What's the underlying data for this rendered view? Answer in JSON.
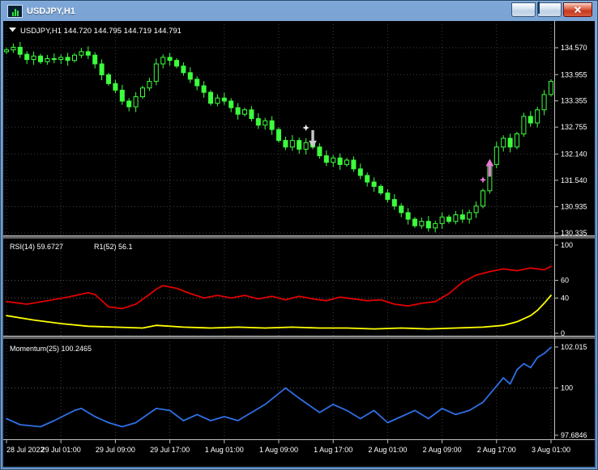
{
  "window": {
    "title": "USDJPY,H1"
  },
  "chart": {
    "ohlc_line": "USDJPY,H1 144.720 144.795 144.719 144.791"
  },
  "indicators": {
    "rsi": "RSI(14) 59.6727",
    "r1": "R1(52) 56.1",
    "momentum": "Momentum(25) 100.2465"
  },
  "colors": {
    "candle": "#3dff3d",
    "bull_fill": "#000000",
    "grid": "#3e3e3e",
    "level": "#5a5a5a",
    "frame": "#c0c0c0",
    "rsi_line": "#e00000",
    "r1_line": "#ffff00",
    "momentum_line": "#2f6fe4",
    "arrow_down": "#c9c9c9",
    "arrow_up": "#e878d8",
    "star_down": "#f2f2f2",
    "star_up": "#e878d8",
    "axis_text": "#ffffff"
  },
  "chart_data": [
    {
      "type": "candlestick",
      "symbol": "USDJPY",
      "timeframe": "H1",
      "ylim": [
        130.335,
        134.57
      ],
      "first_open": 134.48,
      "closes": [
        134.52,
        134.58,
        134.42,
        134.3,
        134.38,
        134.25,
        134.32,
        134.3,
        134.35,
        134.28,
        134.4,
        134.48,
        134.4,
        134.2,
        133.95,
        133.75,
        133.6,
        133.35,
        133.22,
        133.45,
        133.65,
        133.8,
        134.2,
        134.35,
        134.28,
        134.15,
        134.0,
        133.85,
        133.7,
        133.55,
        133.3,
        133.42,
        133.35,
        133.2,
        133.05,
        133.15,
        132.95,
        132.8,
        132.9,
        132.7,
        132.45,
        132.3,
        132.45,
        132.25,
        132.4,
        132.3,
        132.1,
        131.95,
        132.05,
        131.9,
        132.0,
        131.8,
        131.65,
        131.5,
        131.4,
        131.25,
        131.1,
        130.95,
        130.8,
        130.65,
        130.5,
        130.6,
        130.45,
        130.55,
        130.7,
        130.6,
        130.75,
        130.65,
        130.8,
        130.95,
        131.3,
        131.9,
        132.3,
        132.5,
        132.3,
        132.6,
        133.0,
        132.85,
        133.15,
        133.5,
        133.8
      ],
      "price_axis_labels": [
        "134.570",
        "133.955",
        "133.355",
        "132.755",
        "132.140",
        "131.540",
        "130.935",
        "130.335"
      ],
      "time_axis_labels": [
        {
          "i": 0,
          "label": "28 Jul 2022"
        },
        {
          "i": 8,
          "label": "29 Jul 01:00"
        },
        {
          "i": 16,
          "label": "29 Jul 09:00"
        },
        {
          "i": 24,
          "label": "29 Jul 17:00"
        },
        {
          "i": 32,
          "label": "1 Aug 01:00"
        },
        {
          "i": 40,
          "label": "1 Aug 09:00"
        },
        {
          "i": 48,
          "label": "1 Aug 17:00"
        },
        {
          "i": 56,
          "label": "2 Aug 01:00"
        },
        {
          "i": 64,
          "label": "2 Aug 09:00"
        },
        {
          "i": 72,
          "label": "2 Aug 17:00"
        },
        {
          "i": 80,
          "label": "3 Aug 01:00"
        }
      ],
      "markers": [
        {
          "kind": "arrow-down",
          "i": 45,
          "price": 132.28
        },
        {
          "kind": "star-down",
          "i": 44,
          "price": 132.74
        },
        {
          "kind": "arrow-up",
          "i": 71,
          "price": 132.03
        },
        {
          "kind": "star-up",
          "i": 70,
          "price": 131.55
        }
      ]
    },
    {
      "type": "line",
      "name": "RSI",
      "ylim": [
        0,
        100
      ],
      "axis_labels": [
        "100",
        "60",
        "40",
        "0"
      ],
      "levels": [
        60,
        40
      ],
      "series": [
        {
          "name": "RSI(14)",
          "points": [
            [
              0,
              36
            ],
            [
              3,
              33
            ],
            [
              6,
              37
            ],
            [
              9,
              41
            ],
            [
              12,
              46
            ],
            [
              13,
              44
            ],
            [
              15,
              30
            ],
            [
              17,
              28
            ],
            [
              19,
              33
            ],
            [
              21,
              44
            ],
            [
              22,
              50
            ],
            [
              23,
              54
            ],
            [
              25,
              51
            ],
            [
              27,
              45
            ],
            [
              29,
              40
            ],
            [
              31,
              43
            ],
            [
              33,
              40
            ],
            [
              35,
              43
            ],
            [
              37,
              39
            ],
            [
              39,
              42
            ],
            [
              41,
              38
            ],
            [
              43,
              42
            ],
            [
              45,
              39
            ],
            [
              47,
              37
            ],
            [
              49,
              41
            ],
            [
              51,
              39
            ],
            [
              53,
              37
            ],
            [
              55,
              38
            ],
            [
              57,
              33
            ],
            [
              59,
              31
            ],
            [
              61,
              34
            ],
            [
              63,
              36
            ],
            [
              65,
              45
            ],
            [
              67,
              58
            ],
            [
              69,
              66
            ],
            [
              71,
              70
            ],
            [
              73,
              73
            ],
            [
              75,
              71
            ],
            [
              77,
              74
            ],
            [
              79,
              72
            ],
            [
              80,
              76
            ]
          ]
        },
        {
          "name": "R1(52)",
          "points": [
            [
              0,
              20
            ],
            [
              4,
              15
            ],
            [
              8,
              11
            ],
            [
              12,
              8
            ],
            [
              16,
              7
            ],
            [
              20,
              6
            ],
            [
              22,
              9
            ],
            [
              26,
              7
            ],
            [
              30,
              6
            ],
            [
              34,
              7
            ],
            [
              38,
              6
            ],
            [
              42,
              7
            ],
            [
              46,
              6
            ],
            [
              50,
              6
            ],
            [
              54,
              5
            ],
            [
              58,
              6
            ],
            [
              62,
              5
            ],
            [
              66,
              6
            ],
            [
              70,
              7
            ],
            [
              73,
              9
            ],
            [
              75,
              13
            ],
            [
              77,
              20
            ],
            [
              78,
              26
            ],
            [
              79,
              34
            ],
            [
              80,
              43
            ]
          ]
        }
      ]
    },
    {
      "type": "line",
      "name": "Momentum",
      "ylim": [
        97.6846,
        102.015
      ],
      "axis_labels": [
        "102.015",
        "100",
        "97.6846"
      ],
      "levels": [
        100
      ],
      "series": [
        {
          "name": "Momentum(25)",
          "points": [
            [
              0,
              98.5
            ],
            [
              2,
              98.2
            ],
            [
              5,
              98.1
            ],
            [
              7,
              98.4
            ],
            [
              10,
              98.9
            ],
            [
              11,
              99.0
            ],
            [
              13,
              98.6
            ],
            [
              15,
              98.3
            ],
            [
              17,
              98.1
            ],
            [
              19,
              98.3
            ],
            [
              22,
              99.0
            ],
            [
              24,
              98.9
            ],
            [
              26,
              98.4
            ],
            [
              28,
              98.7
            ],
            [
              30,
              98.4
            ],
            [
              32,
              98.6
            ],
            [
              34,
              98.4
            ],
            [
              36,
              98.8
            ],
            [
              38,
              99.2
            ],
            [
              41,
              100.0
            ],
            [
              43,
              99.5
            ],
            [
              46,
              98.8
            ],
            [
              48,
              99.2
            ],
            [
              50,
              98.9
            ],
            [
              52,
              98.5
            ],
            [
              54,
              98.9
            ],
            [
              56,
              98.3
            ],
            [
              58,
              98.6
            ],
            [
              60,
              98.9
            ],
            [
              62,
              98.5
            ],
            [
              64,
              99.0
            ],
            [
              66,
              98.7
            ],
            [
              68,
              98.9
            ],
            [
              70,
              99.3
            ],
            [
              72,
              100.1
            ],
            [
              73,
              100.5
            ],
            [
              74,
              100.2
            ],
            [
              75,
              100.9
            ],
            [
              76,
              101.2
            ],
            [
              77,
              101.0
            ],
            [
              78,
              101.5
            ],
            [
              79,
              101.7
            ],
            [
              80,
              102.0
            ]
          ]
        }
      ]
    }
  ]
}
